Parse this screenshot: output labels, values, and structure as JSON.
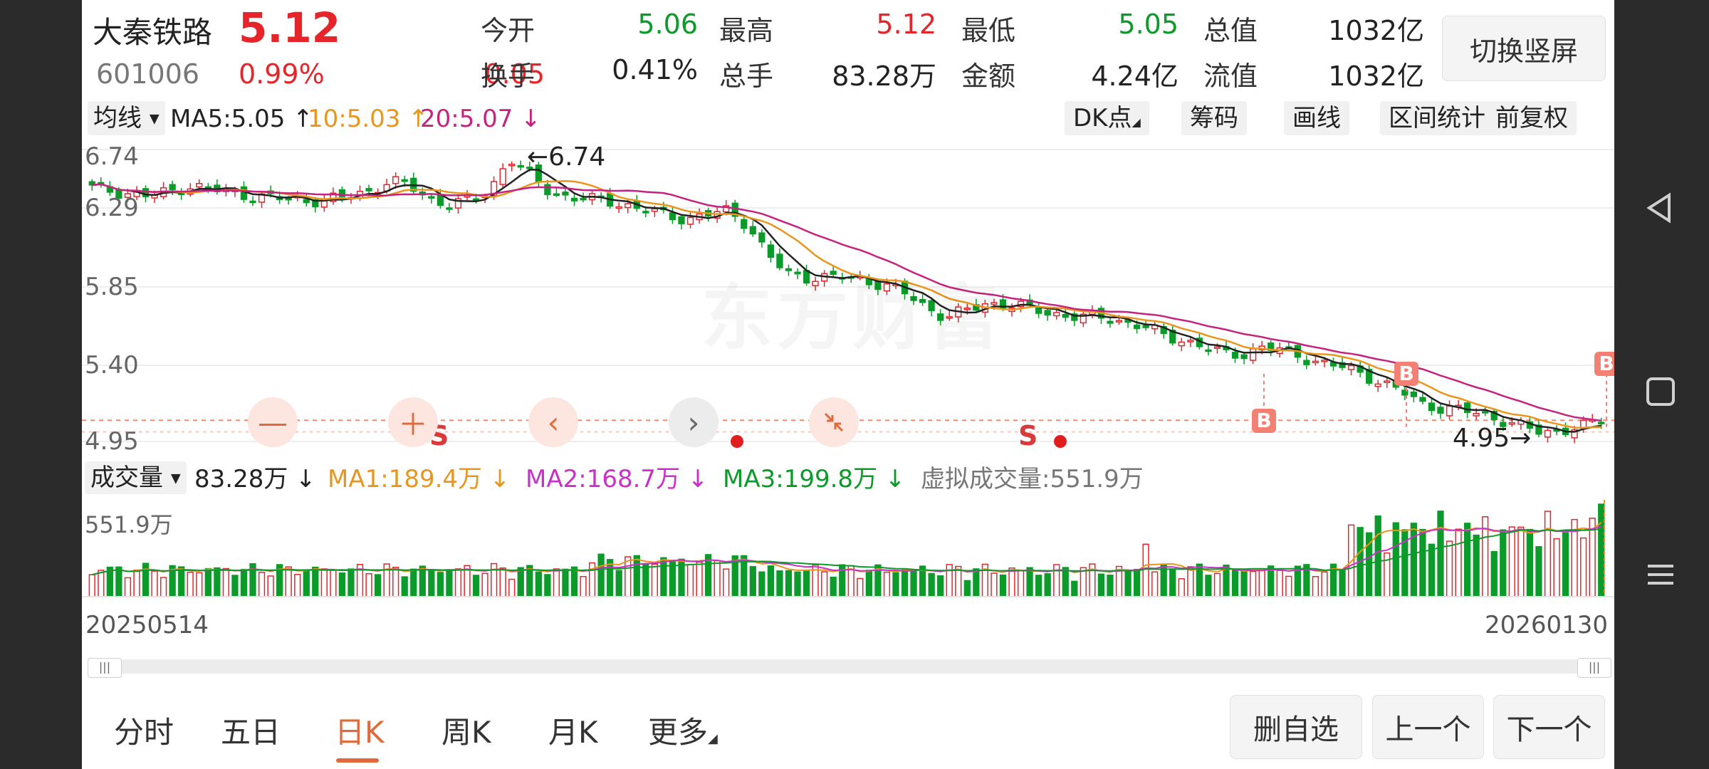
{
  "header": {
    "name": "大秦铁路",
    "price": "5.12",
    "code": "601006",
    "pct": "0.99%",
    "change": "0.05",
    "quotes": [
      {
        "label": "今开",
        "value": "5.06",
        "color": "green"
      },
      {
        "label": "最高",
        "value": "5.12",
        "color": "red"
      },
      {
        "label": "最低",
        "value": "5.05",
        "color": "green"
      },
      {
        "label": "总值",
        "value": "1032亿",
        "color": "dark"
      },
      {
        "label": "换手",
        "value": "0.41%",
        "color": "dark"
      },
      {
        "label": "总手",
        "value": "83.28万",
        "color": "dark"
      },
      {
        "label": "金额",
        "value": "4.24亿",
        "color": "dark"
      },
      {
        "label": "流值",
        "value": "1032亿",
        "color": "dark"
      }
    ],
    "switch_label": "切换竖屏"
  },
  "toolbar": {
    "ma_select": "均线",
    "ma5": "MA5:5.05",
    "ma10": "10:5.03",
    "ma20": "20:5.07",
    "dk": "DK点",
    "chip": "筹码",
    "draw": "画线",
    "range": "区间统计",
    "adjust": "前复权"
  },
  "volume": {
    "select": "成交量",
    "current": "83.28万",
    "ma1": "MA1:189.4万",
    "ma2": "MA2:168.7万",
    "ma3": "MA3:199.8万",
    "virtual": "虚拟成交量:551.9万",
    "max_label": "551.9万"
  },
  "chart": {
    "price_labels": [
      "6.74",
      "6.29",
      "5.85",
      "5.40",
      "4.95"
    ],
    "high_label": "6.74",
    "low_label": "4.95",
    "watermark": "东方财富",
    "signal_s": "S",
    "signal_b": "B",
    "date_start": "20250514",
    "date_end": "20260130"
  },
  "colors": {
    "up": "#e5252a",
    "down": "#0c9a2a",
    "ma5": "#222222",
    "ma10": "#e8961e",
    "ma20": "#c4237f",
    "accent": "#e06a3b"
  },
  "tabs": [
    "分时",
    "五日",
    "日K",
    "周K",
    "月K",
    "更多"
  ],
  "active_tab": "日K",
  "buttons": {
    "delete": "删自选",
    "prev": "上一个",
    "next": "下一个"
  },
  "chart_data": {
    "type": "candlestick",
    "x_start": "20250514",
    "x_end": "20260130",
    "ylim": [
      4.95,
      6.74
    ],
    "approx_close_trend": [
      6.52,
      6.5,
      6.48,
      6.47,
      6.5,
      6.53,
      6.51,
      6.49,
      6.47,
      6.46,
      6.45,
      6.44,
      6.45,
      6.47,
      6.5,
      6.56,
      6.53,
      6.45,
      6.42,
      6.44,
      6.5,
      6.7,
      6.6,
      6.5,
      6.46,
      6.45,
      6.44,
      6.41,
      6.38,
      6.35,
      6.33,
      6.36,
      6.38,
      6.3,
      6.12,
      6.0,
      5.98,
      5.98,
      5.98,
      5.96,
      5.93,
      5.88,
      5.8,
      5.74,
      5.78,
      5.82,
      5.82,
      5.8,
      5.77,
      5.75,
      5.74,
      5.74,
      5.71,
      5.68,
      5.63,
      5.6,
      5.56,
      5.52,
      5.52,
      5.56,
      5.54,
      5.5,
      5.46,
      5.44,
      5.4,
      5.34,
      5.29,
      5.22,
      5.19,
      5.18,
      5.16,
      5.12,
      5.08,
      5.05,
      5.06,
      5.08,
      5.12
    ],
    "volume_max": "551.9万"
  }
}
